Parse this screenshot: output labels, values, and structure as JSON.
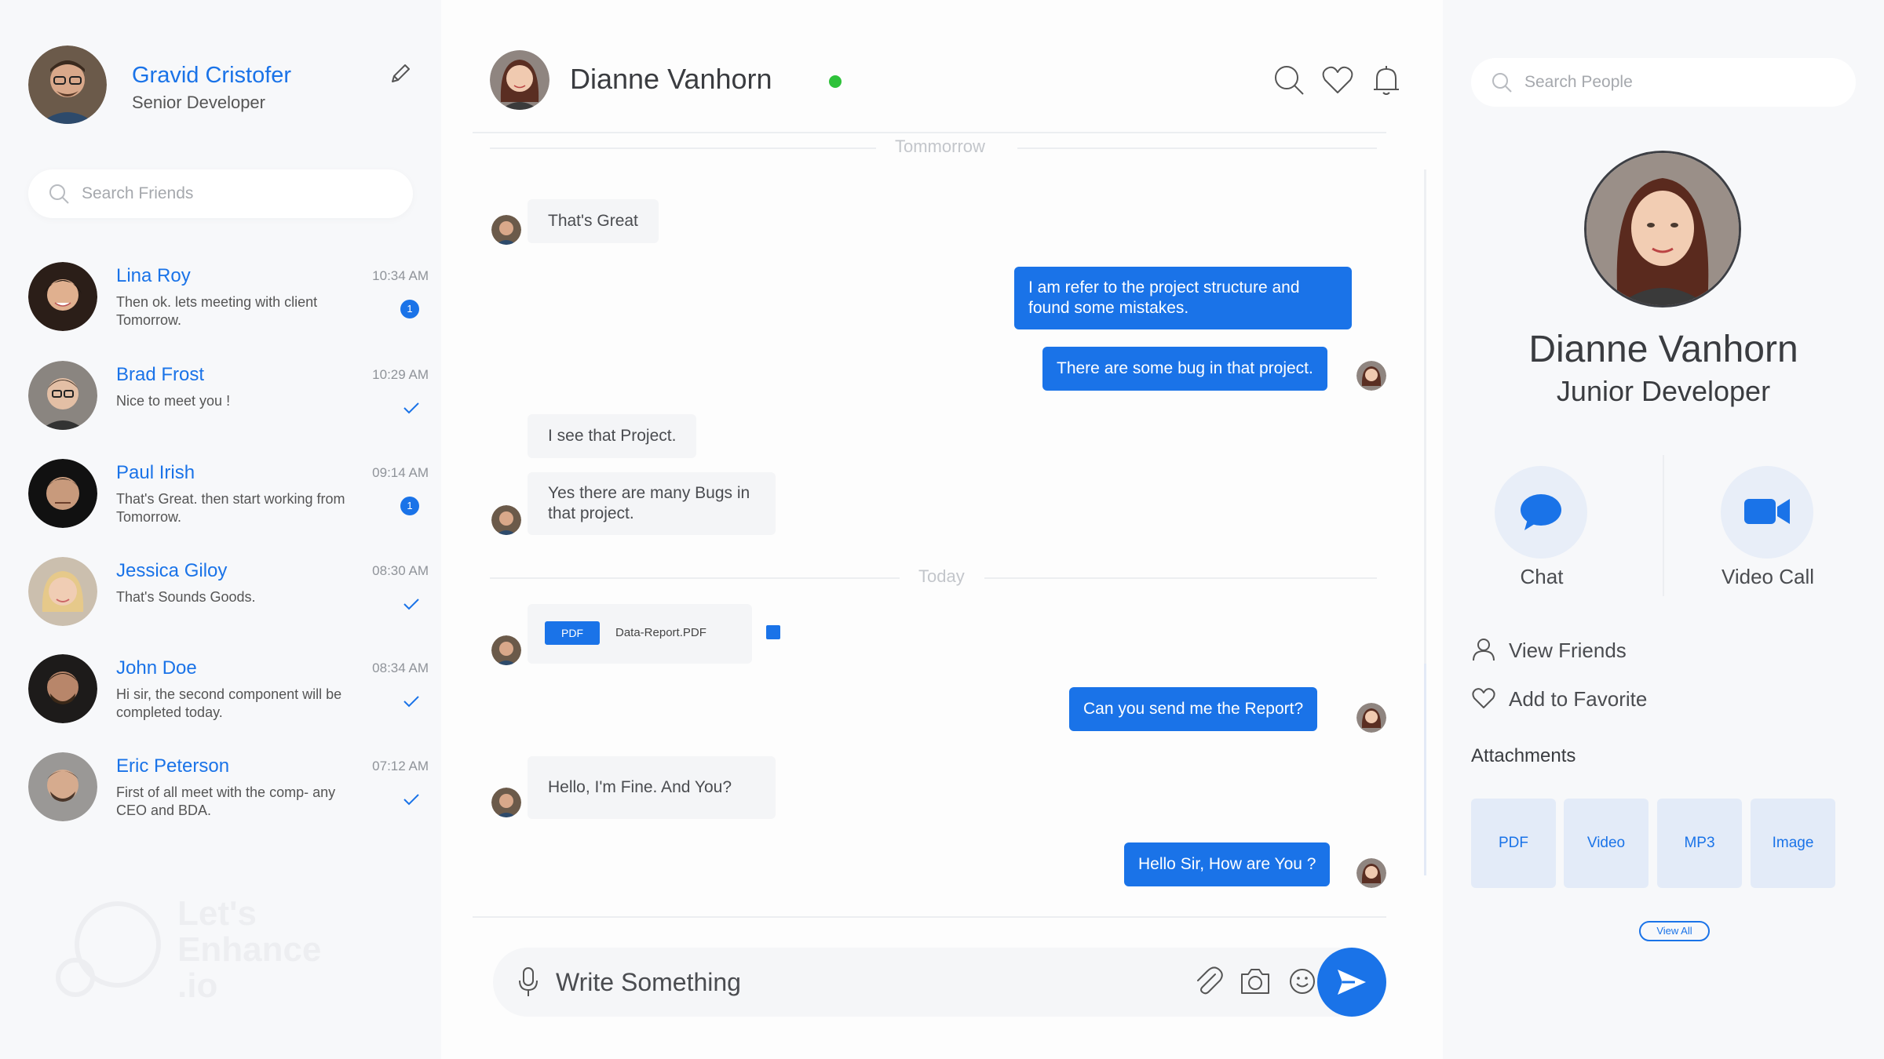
{
  "current_user": {
    "name": "Gravid Cristofer",
    "role": "Senior Developer",
    "avatar_icon": "user-avatar-icon"
  },
  "friends_search": {
    "placeholder": "Search Friends"
  },
  "friends": [
    {
      "name": "Lina Roy",
      "message": "Then ok. lets meeting with client Tomorrow.",
      "time": "10:34 AM",
      "unread": "1",
      "status": "unread"
    },
    {
      "name": "Brad Frost",
      "message": "Nice to meet you !",
      "time": "10:29 AM",
      "unread": "",
      "status": "read"
    },
    {
      "name": "Paul Irish",
      "message": "That's Great. then start working from Tomorrow.",
      "time": "09:14 AM",
      "unread": "1",
      "status": "unread"
    },
    {
      "name": "Jessica Giloy",
      "message": "That's Sounds Goods.",
      "time": "08:30 AM",
      "unread": "",
      "status": "read"
    },
    {
      "name": "John Doe",
      "message": "Hi sir, the second component will be completed today.",
      "time": "08:34 AM",
      "unread": "",
      "status": "read"
    },
    {
      "name": "Eric Peterson",
      "message": "First of all meet with the comp- any CEO and BDA.",
      "time": "07:12 AM",
      "unread": "",
      "status": "read"
    }
  ],
  "watermark": {
    "text_line1": "Let's",
    "text_line2": "Enhance",
    "text_line3": ".io"
  },
  "chat": {
    "contact_name": "Dianne Vanhorn",
    "online": true,
    "day_labels": [
      "Tommorrow",
      "Today"
    ],
    "messages": [
      {
        "dir": "in",
        "text": "That's Great"
      },
      {
        "dir": "out",
        "text": "I am refer to the project structure and found some mistakes."
      },
      {
        "dir": "out",
        "text": "There are some bug in that project."
      },
      {
        "dir": "in",
        "text": "I see that Project."
      },
      {
        "dir": "in",
        "text": "Yes there are many Bugs in that project."
      },
      {
        "dir": "in",
        "type": "file",
        "file_type": "PDF",
        "file_name": "Data-Report.PDF"
      },
      {
        "dir": "out",
        "text": "Can you send me the Report?"
      },
      {
        "dir": "in",
        "text": "Hello, I'm Fine. And You?"
      },
      {
        "dir": "out",
        "text": "Hello Sir, How are You ?"
      }
    ],
    "composer_placeholder": "Write Something"
  },
  "profile": {
    "search_placeholder": "Search People",
    "name": "Dianne Vanhorn",
    "role": "Junior Developer",
    "actions": [
      {
        "label": "Chat",
        "icon": "chat-bubble-icon"
      },
      {
        "label": "Video Call",
        "icon": "video-camera-icon"
      }
    ],
    "links": [
      {
        "label": "View Friends",
        "icon": "user-icon"
      },
      {
        "label": "Add to Favorite",
        "icon": "heart-icon"
      }
    ],
    "attachments_title": "Attachments",
    "attachments": [
      "PDF",
      "Video",
      "MP3",
      "Image"
    ],
    "view_all": "View All"
  },
  "colors": {
    "accent": "#1a73e8",
    "online": "#2ec23a",
    "bubble_in": "#f4f5f7",
    "panel_bg": "#f7f8fa"
  }
}
